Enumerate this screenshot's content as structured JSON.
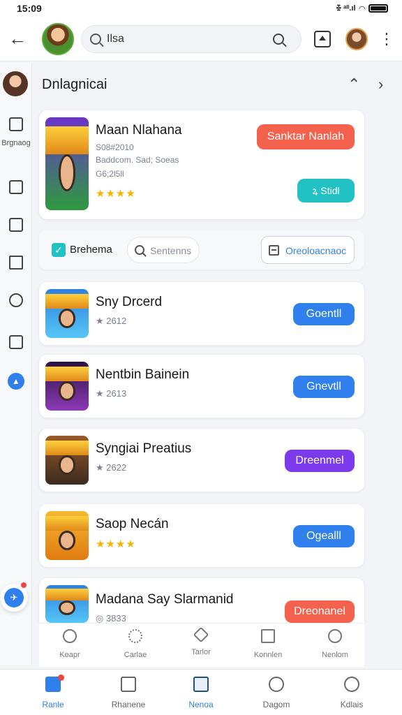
{
  "status": {
    "time": "15:09",
    "signal_text": "ꔀ ᵃᴵᴵ.ıl"
  },
  "appbar": {
    "search_query": "Ilsa"
  },
  "section": {
    "title": "Dnlagnicai"
  },
  "rail": {
    "items": [
      {
        "label": "Brgnaog"
      }
    ]
  },
  "featured": {
    "title": "Maan Nlahana",
    "meta1": "S08#2010",
    "meta2": "Baddcom. Sad; Soeas",
    "meta3": "G6;2l5ll",
    "stars": "★★★★",
    "primary_button": "Sanktar Nanlah",
    "secondary_button": "ꝝ Stidl",
    "primary_color": "#f4624d",
    "secondary_color": "#22c1c3"
  },
  "filter": {
    "checkbox_label": "Brehema",
    "search_placeholder": "Sentenns",
    "button_label": "Oreoloacnaoc"
  },
  "list": [
    {
      "title": "Sny Drcerd",
      "rating": "★ 2612",
      "button": "Goentll",
      "color": "#2f80ed"
    },
    {
      "title": "Nentbin Bainein",
      "rating": "★ 2613",
      "button": "Gnevtll",
      "color": "#2f80ed"
    },
    {
      "title": "Syngiai Preatius",
      "rating": "★ 2622",
      "button": "Dreenmel",
      "color": "#7c3aed"
    },
    {
      "title": "Saop Necán",
      "rating": "★★★★",
      "button": "Ogealll",
      "color": "#2f80ed"
    },
    {
      "title": "Madana Say Slarmanid",
      "rating": "◎ 3833",
      "button": "Dreonanel",
      "color": "#f4624d"
    }
  ],
  "quickbar": [
    "Keapr",
    "Carlae",
    "Tarlor",
    "Konnlen",
    "Nenlom"
  ],
  "bottomnav": [
    {
      "label": "Ranle",
      "active": true
    },
    {
      "label": "Rhanene",
      "active": false
    },
    {
      "label": "Nenoa",
      "active": false
    },
    {
      "label": "Dagom",
      "active": false
    },
    {
      "label": "Kdlais",
      "active": false
    }
  ],
  "colors": {
    "accent": "#2f80ed",
    "teal": "#22c1c3",
    "purple": "#7c3aed",
    "coral": "#f4624d"
  }
}
